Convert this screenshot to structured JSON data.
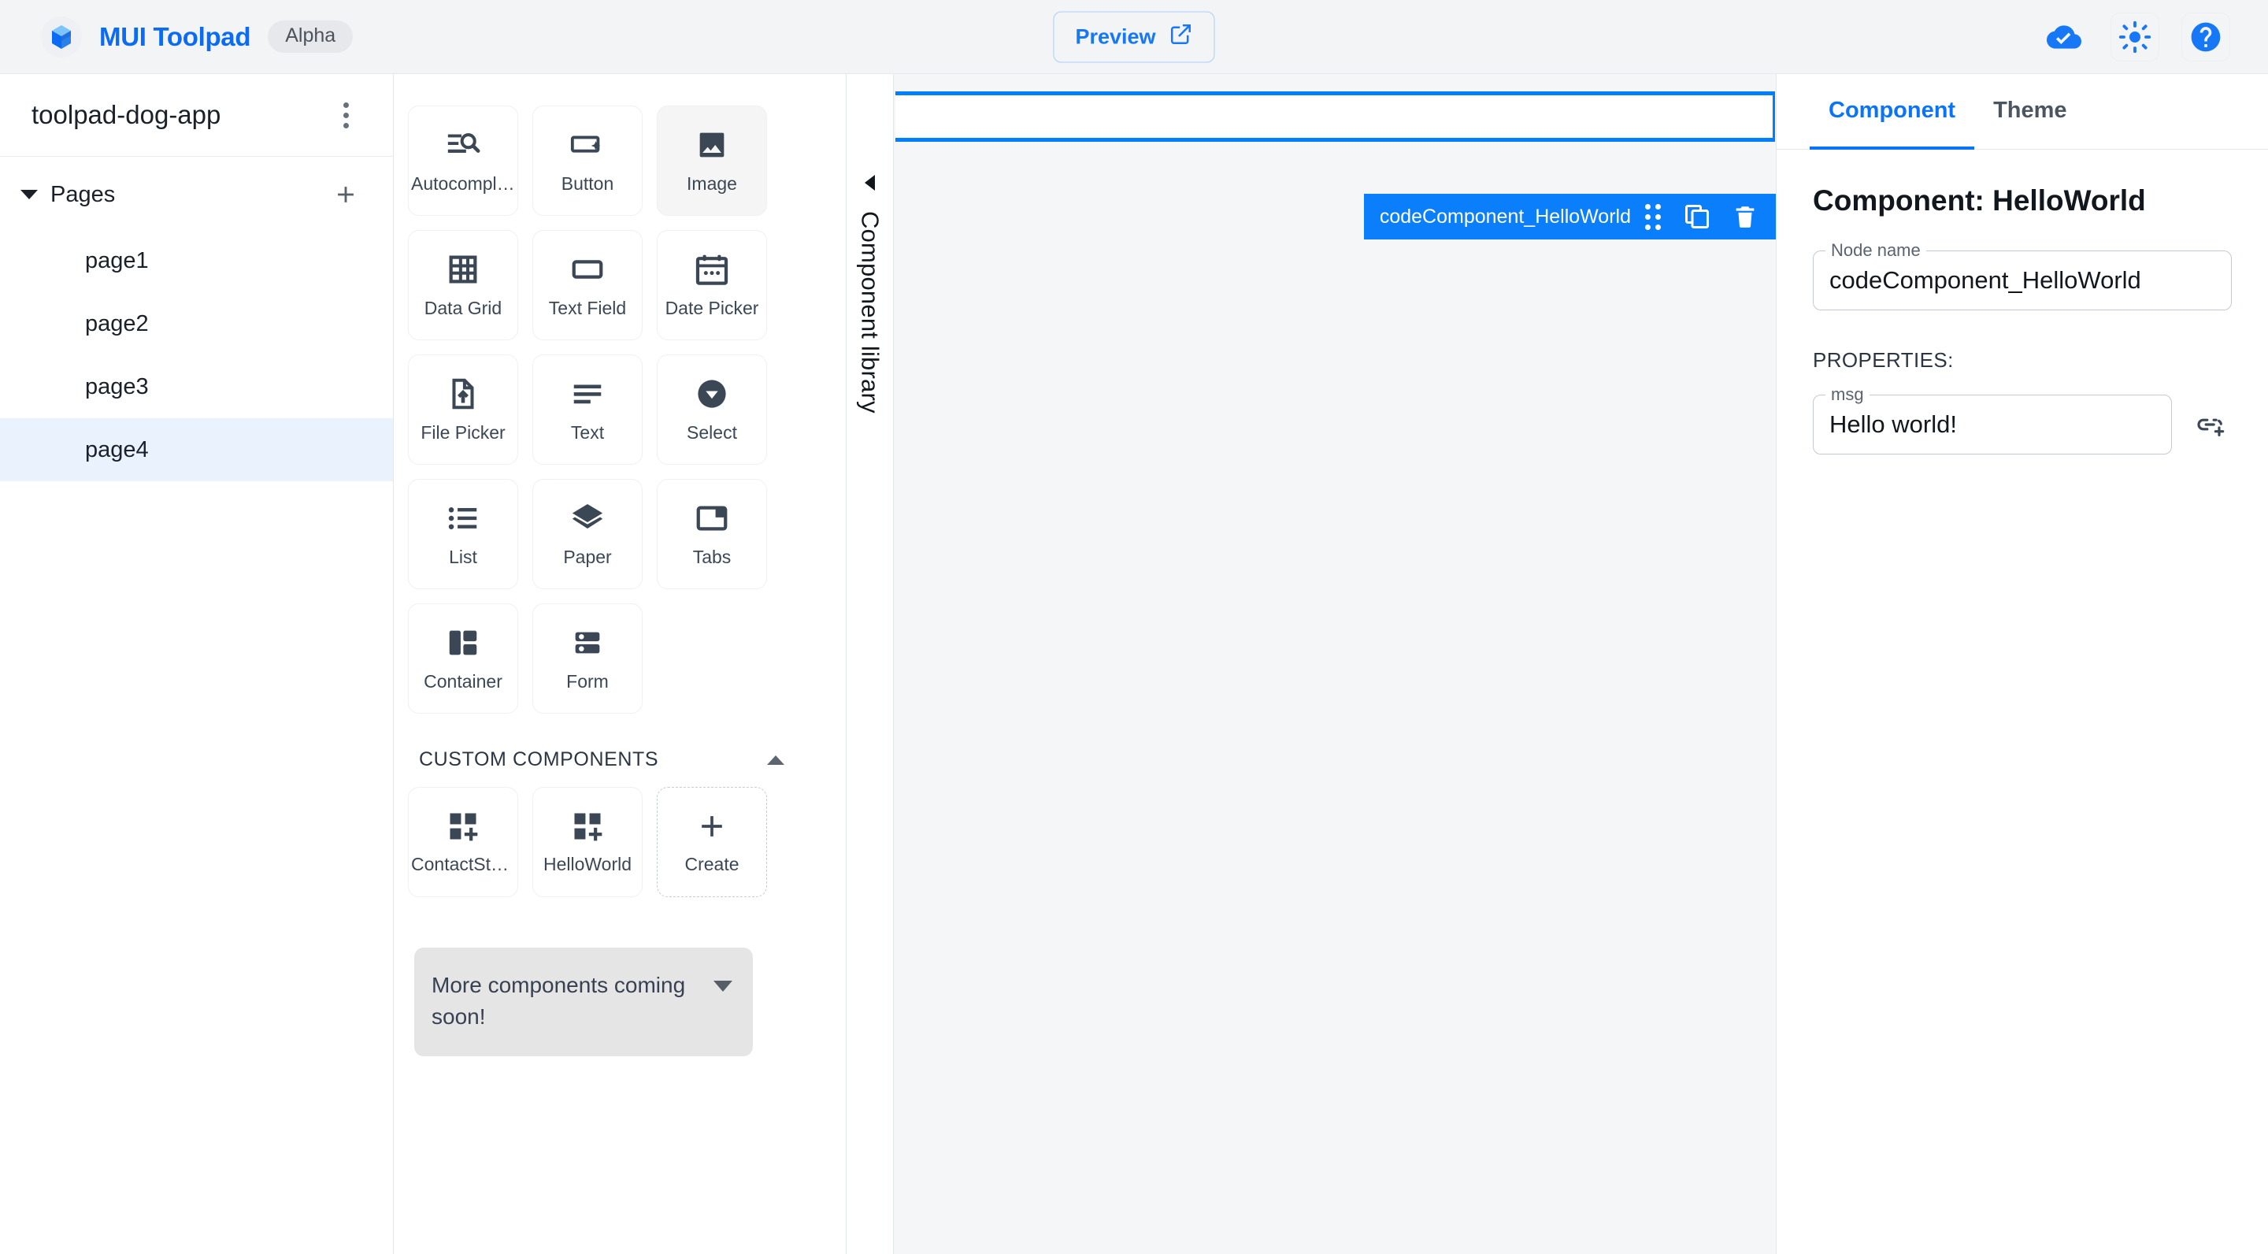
{
  "header": {
    "logo_icon": "toolpad-cube-logo",
    "brand_name": "MUI Toolpad",
    "alpha_chip": "Alpha",
    "preview_label": "Preview",
    "preview_icon": "open-in-new-icon",
    "save_status_icon": "cloud-done-icon",
    "theme_toggle_icon": "brightness-sun-icon",
    "help_icon": "help-circle-icon",
    "accent_color": "#0b6bf2"
  },
  "sidebar": {
    "app_title": "toolpad-dog-app",
    "menu_icon": "more-vertical-icon",
    "pages_label": "Pages",
    "expand_icon": "chevron-down-icon",
    "add_icon": "plus-icon",
    "pages": [
      {
        "label": "page1",
        "selected": false
      },
      {
        "label": "page2",
        "selected": false
      },
      {
        "label": "page3",
        "selected": false
      },
      {
        "label": "page4",
        "selected": true
      }
    ],
    "selected_bg": "#e9f2fd"
  },
  "component_library": {
    "rail_label": "Component library",
    "collapse_icon": "chevron-left-icon",
    "components": [
      {
        "label": "Autocomplete",
        "icon": "autocomplete-icon",
        "state": "normal"
      },
      {
        "label": "Button",
        "icon": "button-icon",
        "state": "normal"
      },
      {
        "label": "Image",
        "icon": "image-icon",
        "state": "hovered"
      },
      {
        "label": "Data Grid",
        "icon": "data-grid-icon",
        "state": "normal"
      },
      {
        "label": "Text Field",
        "icon": "text-field-icon",
        "state": "normal"
      },
      {
        "label": "Date Picker",
        "icon": "date-picker-icon",
        "state": "normal"
      },
      {
        "label": "File Picker",
        "icon": "file-picker-icon",
        "state": "normal"
      },
      {
        "label": "Text",
        "icon": "text-icon",
        "state": "normal"
      },
      {
        "label": "Select",
        "icon": "select-icon",
        "state": "normal"
      },
      {
        "label": "List",
        "icon": "list-icon",
        "state": "normal"
      },
      {
        "label": "Paper",
        "icon": "paper-layers-icon",
        "state": "normal"
      },
      {
        "label": "Tabs",
        "icon": "tabs-icon",
        "state": "normal"
      },
      {
        "label": "Container",
        "icon": "container-icon",
        "state": "normal"
      },
      {
        "label": "Form",
        "icon": "form-icon",
        "state": "normal"
      }
    ],
    "custom_section": {
      "title": "CUSTOM COMPONENTS",
      "collapse_icon": "chevron-up-icon",
      "items": [
        {
          "label": "ContactSta...",
          "icon": "custom-component-icon",
          "style": "solid"
        },
        {
          "label": "HelloWorld",
          "icon": "custom-component-icon",
          "style": "solid"
        },
        {
          "label": "Create",
          "icon": "plus-icon",
          "style": "dashed"
        }
      ]
    },
    "accordion": {
      "text": "More components coming soon!",
      "chevron_icon": "chevron-down-icon"
    }
  },
  "canvas": {
    "selection": {
      "node_name": "codeComponent_HelloWorld",
      "drag_icon": "drag-handle-dots-icon",
      "duplicate_icon": "copy-icon",
      "delete_icon": "trash-icon",
      "outline_color": "#007ffd"
    }
  },
  "inspector": {
    "tabs": [
      {
        "label": "Component",
        "active": true
      },
      {
        "label": "Theme",
        "active": false
      }
    ],
    "title": "Component: HelloWorld",
    "node_name_label": "Node name",
    "node_name_value": "codeComponent_HelloWorld",
    "properties_label": "PROPERTIES:",
    "properties": [
      {
        "label": "msg",
        "value": "Hello world!",
        "bind_icon": "add-link-binding-icon"
      }
    ]
  }
}
